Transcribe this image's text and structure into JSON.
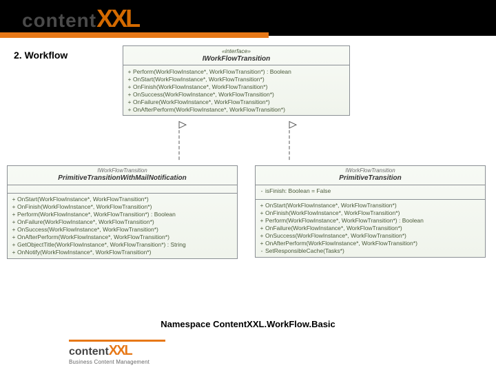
{
  "header": {
    "brand_text": "content",
    "brand_xl": "XXL"
  },
  "section_title": "2. Workflow",
  "caption": "Namespace ContentXXL.WorkFlow.Basic",
  "footer": {
    "brand_text": "content",
    "brand_xl": "XXL",
    "tagline": "Business Content Management"
  },
  "classes": {
    "interface": {
      "stereotype": "«interface»",
      "name": "IWorkFlowTransition",
      "implements": "",
      "attrs": [],
      "ops": [
        {
          "v": "+",
          "s": "Perform(WorkFlowInstance*, WorkFlowTransition*) : Boolean"
        },
        {
          "v": "+",
          "s": "OnStart(WorkFlowInstance*, WorkFlowTransition*)"
        },
        {
          "v": "+",
          "s": "OnFinish(WorkFlowInstance*, WorkFlowTransition*)"
        },
        {
          "v": "+",
          "s": "OnSuccess(WorkFlowInstance*, WorkFlowTransition*)"
        },
        {
          "v": "+",
          "s": "OnFailure(WorkFlowInstance*, WorkFlowTransition*)"
        },
        {
          "v": "+",
          "s": "OnAfterPerform(WorkFlowInstance*, WorkFlowTransition*)"
        }
      ]
    },
    "left": {
      "stereotype": "",
      "implements": "IWorkFlowTransition",
      "name": "PrimitiveTransitionWithMailNotification",
      "attrs": [],
      "ops": [
        {
          "v": "+",
          "s": "OnStart(WorkFlowInstance*, WorkFlowTransition*)"
        },
        {
          "v": "+",
          "s": "OnFinish(WorkFlowInstance*, WorkFlowTransition*)"
        },
        {
          "v": "+",
          "s": "Perform(WorkFlowInstance*, WorkFlowTransition*) : Boolean"
        },
        {
          "v": "+",
          "s": "OnFailure(WorkFlowInstance*, WorkFlowTransition*)"
        },
        {
          "v": "+",
          "s": "OnSuccess(WorkFlowInstance*, WorkFlowTransition*)"
        },
        {
          "v": "+",
          "s": "OnAfterPerform(WorkFlowInstance*, WorkFlowTransition*)"
        },
        {
          "v": "+",
          "s": "GetObjectTitle(WorkFlowInstance*, WorkFlowTransition*) : String"
        },
        {
          "v": "+",
          "s": "OnNotify(WorkFlowInstance*, WorkFlowTransition*)"
        }
      ]
    },
    "right": {
      "stereotype": "",
      "implements": "IWorkFlowTransition",
      "name": "PrimitiveTransition",
      "attrs": [
        {
          "v": "-",
          "s": "isFinish: Boolean = False"
        }
      ],
      "ops": [
        {
          "v": "+",
          "s": "OnStart(WorkFlowInstance*, WorkFlowTransition*)"
        },
        {
          "v": "+",
          "s": "OnFinish(WorkFlowInstance*, WorkFlowTransition*)"
        },
        {
          "v": "+",
          "s": "Perform(WorkFlowInstance*, WorkFlowTransition*) : Boolean"
        },
        {
          "v": "+",
          "s": "OnFailure(WorkFlowInstance*, WorkFlowTransition*)"
        },
        {
          "v": "+",
          "s": "OnSuccess(WorkFlowInstance*, WorkFlowTransition*)"
        },
        {
          "v": "+",
          "s": "OnAfterPerform(WorkFlowInstance*, WorkFlowTransition*)"
        },
        {
          "v": "-",
          "s": "SetResponsibleCache(Tasks*)"
        }
      ]
    }
  }
}
